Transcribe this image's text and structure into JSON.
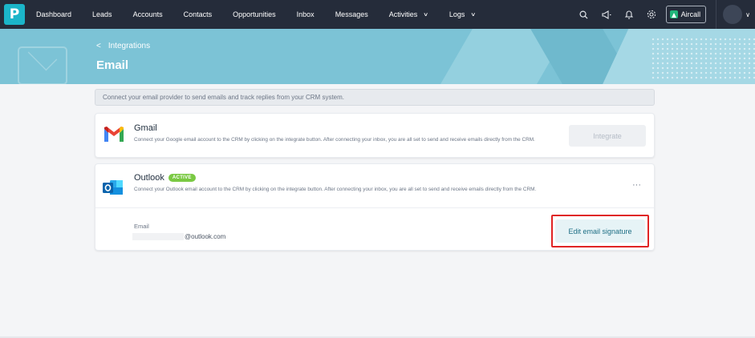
{
  "topbar": {
    "logo": "P",
    "nav": [
      {
        "label": "Dashboard"
      },
      {
        "label": "Leads"
      },
      {
        "label": "Accounts"
      },
      {
        "label": "Contacts"
      },
      {
        "label": "Opportunities"
      },
      {
        "label": "Inbox"
      },
      {
        "label": "Messages"
      },
      {
        "label": "Activities",
        "dropdown": true
      },
      {
        "label": "Logs",
        "dropdown": true
      }
    ],
    "tools": [
      "search-icon",
      "megaphone-icon",
      "bell-icon",
      "gear-icon"
    ],
    "aircall_label": "Aircall"
  },
  "banner": {
    "breadcrumb": "Integrations",
    "title": "Email"
  },
  "info_text": "Connect your email provider to send emails and track replies from your CRM system.",
  "gmail": {
    "title": "Gmail",
    "description": "Connect your Google email account to the CRM by clicking on the integrate button. After connecting your inbox, you are all set to send and receive emails directly from the CRM.",
    "button": "Integrate"
  },
  "outlook": {
    "title": "Outlook",
    "badge": "ACTIVE",
    "description": "Connect your Outlook email account to the CRM by clicking on the integrate button. After connecting your inbox, you are all set to send and receive emails directly from the CRM.",
    "more": "···",
    "email_label": "Email",
    "email_value": "@outlook.com",
    "signature_button": "Edit email signature"
  },
  "colors": {
    "topbar": "#252c3a",
    "brand": "#1bb5c9",
    "banner": "#7cc3d6",
    "badge": "#7ac943",
    "highlight": "#e02424"
  }
}
